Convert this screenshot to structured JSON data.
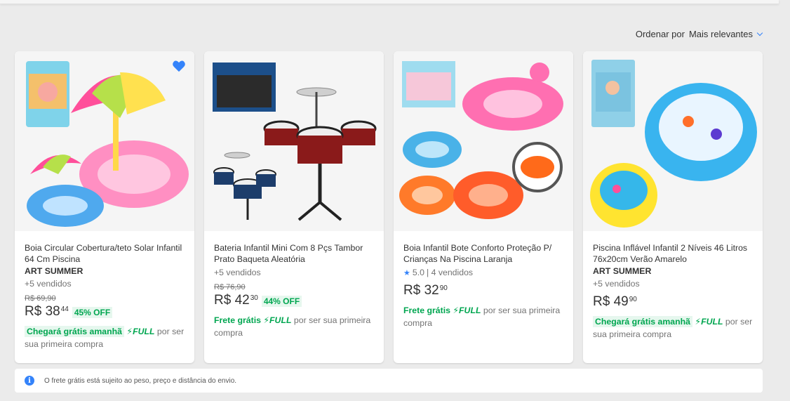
{
  "sort": {
    "label": "Ordenar por",
    "value": "Mais relevantes"
  },
  "products": [
    {
      "title": "Boia Circular Cobertura/teto Solar Infantil 64 Cm Piscina",
      "brand": "ART SUMMER",
      "sold": "+5 vendidos",
      "old_price": "R$ 69,90",
      "price_int": "R$ 38",
      "price_cents": "44",
      "discount": "45% OFF",
      "ship_free": "Chegará grátis amanhã",
      "full": "FULL",
      "ship_rest": "por ser sua primeira compra",
      "favorited": true
    },
    {
      "title": "Bateria Infantil Mini Com 8 Pçs Tambor Prato Baqueta Aleatória",
      "sold": "+5 vendidos",
      "old_price": "R$ 76,90",
      "price_int": "R$ 42",
      "price_cents": "30",
      "discount": "44% OFF",
      "ship_free": "Frete grátis",
      "full": "FULL",
      "ship_rest": "por ser sua primeira compra"
    },
    {
      "title": "Boia Infantil Bote Conforto Proteção P/ Crianças Na Piscina Laranja",
      "rating": "5.0",
      "rating_sold": "| 4 vendidos",
      "price_int": "R$ 32",
      "price_cents": "90",
      "ship_free": "Frete grátis",
      "full": "FULL",
      "ship_rest": "por ser sua primeira compra"
    },
    {
      "title": "Piscina Inflável Infantil 2 Níveis 46 Litros 76x20cm Verão Amarelo",
      "brand": "ART SUMMER",
      "sold": "+5 vendidos",
      "price_int": "R$ 49",
      "price_cents": "90",
      "ship_free": "Chegará grátis amanhã",
      "full": "FULL",
      "ship_rest": "por ser sua primeira compra"
    }
  ],
  "notice": {
    "icon": "info-icon",
    "text": "O frete grátis está sujeito ao peso, preço e distância do envio."
  },
  "colors": {
    "accent": "#3483fa",
    "green": "#00a650",
    "background": "#ebebeb"
  }
}
